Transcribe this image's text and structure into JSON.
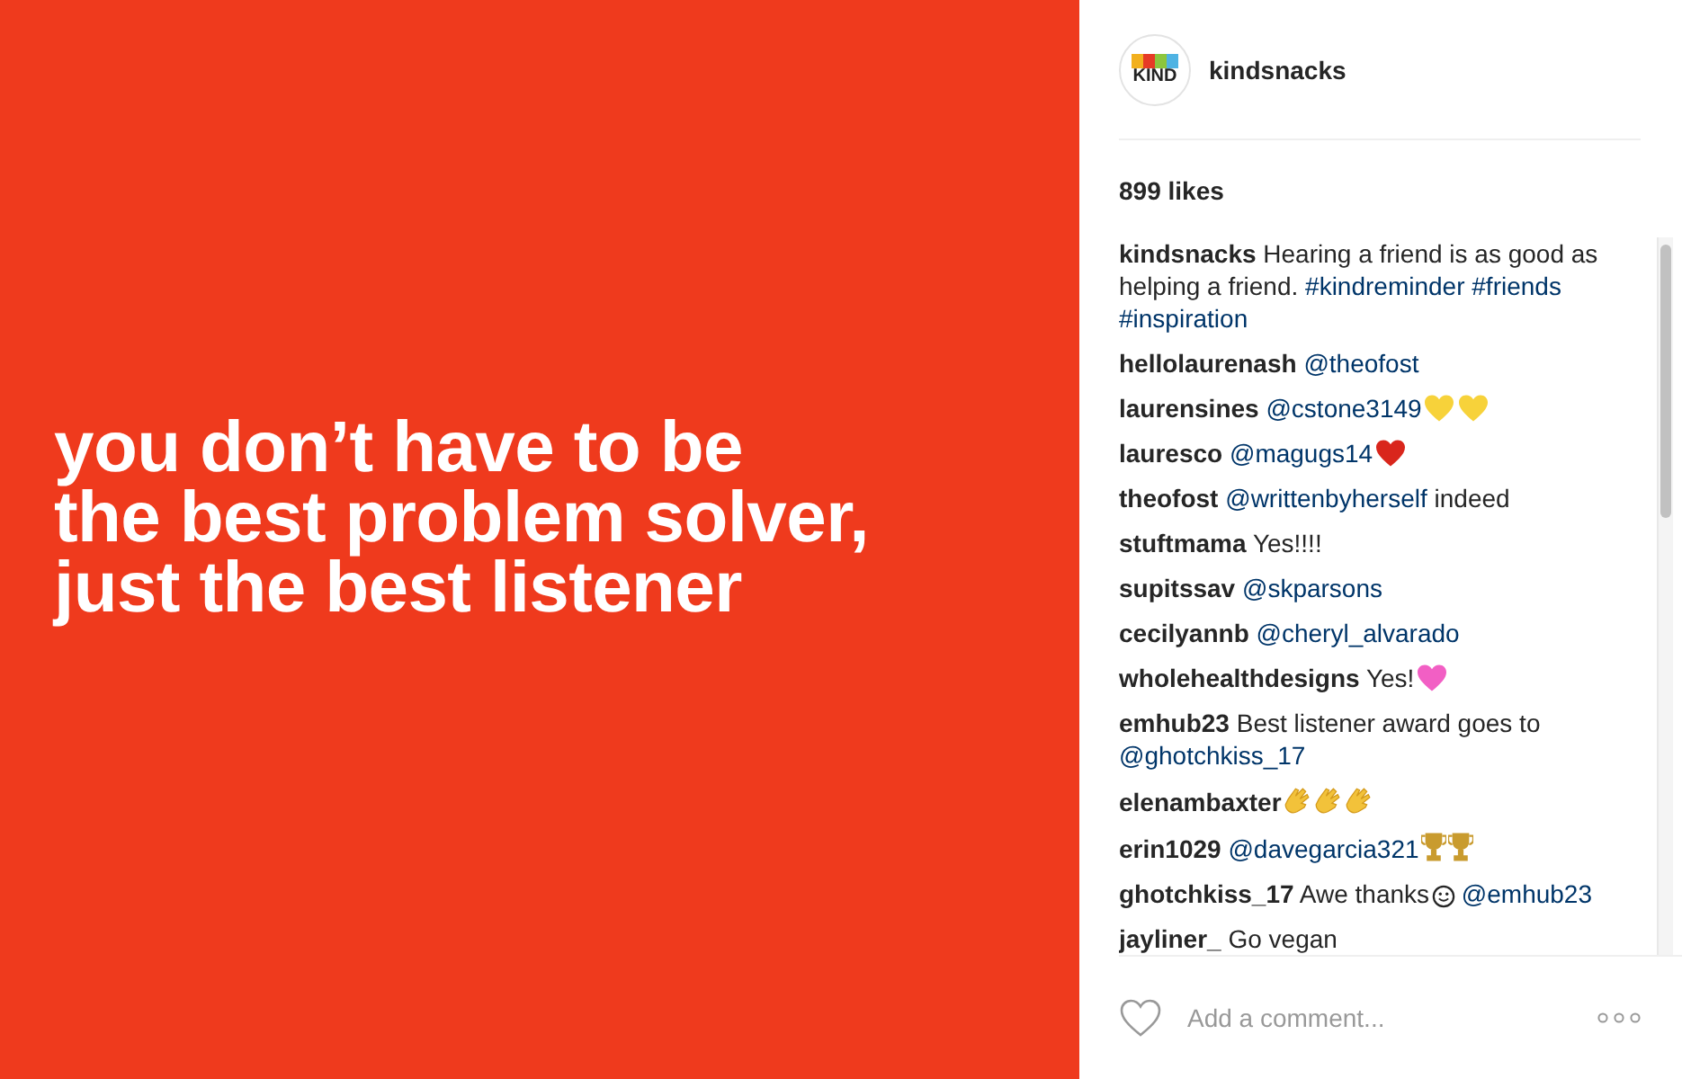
{
  "post_image": {
    "lines": [
      "you don’t have to be",
      "the best problem solver,",
      "just the best listener"
    ]
  },
  "header": {
    "avatar_text": "KIND",
    "username": "kindsnacks"
  },
  "likes": "899 likes",
  "comments": [
    {
      "user": "kindsnacks",
      "segments": [
        {
          "kind": "text",
          "text": "Hearing a friend is as good as helping a friend."
        },
        {
          "kind": "link",
          "text": "#kindreminder"
        },
        {
          "kind": "link",
          "text": "#friends"
        },
        {
          "kind": "link",
          "text": "#inspiration"
        }
      ]
    },
    {
      "user": "hellolaurenash",
      "segments": [
        {
          "kind": "link",
          "text": "@theofost"
        }
      ]
    },
    {
      "user": "laurensines",
      "segments": [
        {
          "kind": "link",
          "text": "@cstone3149"
        },
        {
          "kind": "heart",
          "color": "#f7d23a"
        },
        {
          "kind": "heart",
          "color": "#f7d23a"
        }
      ]
    },
    {
      "user": "lauresco",
      "segments": [
        {
          "kind": "link",
          "text": "@magugs14"
        },
        {
          "kind": "heart",
          "color": "#d9261c"
        }
      ]
    },
    {
      "user": "theofost",
      "segments": [
        {
          "kind": "link",
          "text": "@writtenbyherself"
        },
        {
          "kind": "text",
          "text": "indeed"
        }
      ]
    },
    {
      "user": "stuftmama",
      "segments": [
        {
          "kind": "text",
          "text": "Yes!!!!"
        }
      ]
    },
    {
      "user": "supitssav",
      "segments": [
        {
          "kind": "link",
          "text": "@skparsons"
        }
      ]
    },
    {
      "user": "cecilyannb",
      "segments": [
        {
          "kind": "link",
          "text": "@cheryl_alvarado"
        }
      ]
    },
    {
      "user": "wholehealthdesigns",
      "segments": [
        {
          "kind": "text",
          "text": "Yes!"
        },
        {
          "kind": "heart",
          "color": "#f25fc4"
        }
      ]
    },
    {
      "user": "emhub23",
      "segments": [
        {
          "kind": "text",
          "text": "Best listener award goes to"
        },
        {
          "kind": "link",
          "text": "@ghotchkiss_17"
        }
      ]
    },
    {
      "user": "elenambaxter",
      "segments": [
        {
          "kind": "clap"
        },
        {
          "kind": "clap"
        },
        {
          "kind": "clap"
        }
      ]
    },
    {
      "user": "erin1029",
      "segments": [
        {
          "kind": "link",
          "text": "@davegarcia321"
        },
        {
          "kind": "trophy"
        },
        {
          "kind": "trophy"
        }
      ]
    },
    {
      "user": "ghotchkiss_17",
      "segments": [
        {
          "kind": "text",
          "text": "Awe thanks"
        },
        {
          "kind": "smile"
        },
        {
          "kind": "link",
          "text": "@emhub23"
        }
      ]
    },
    {
      "user": "jayliner_",
      "segments": [
        {
          "kind": "text",
          "text": "Go vegan"
        }
      ]
    }
  ],
  "comment_field": {
    "placeholder": "Add a comment..."
  }
}
